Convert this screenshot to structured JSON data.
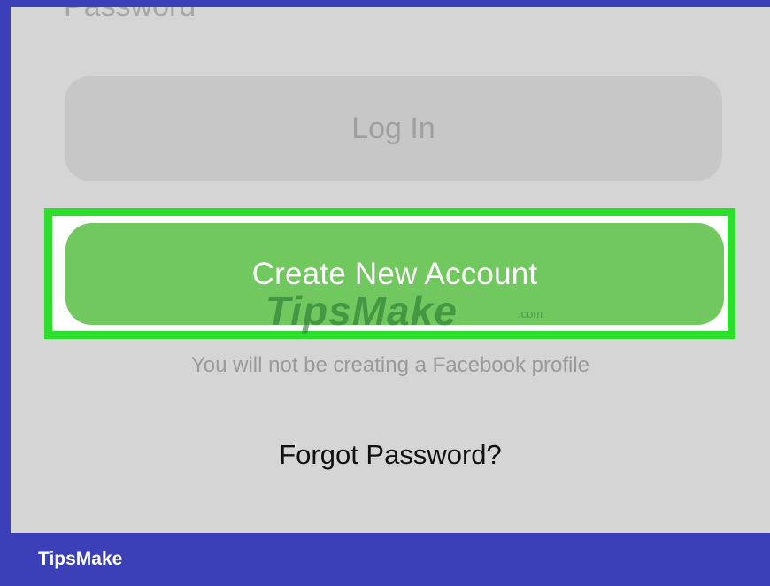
{
  "app": {
    "watermark_brand": "TipsMake",
    "watermark_suffix": ".com",
    "brand_label": "TipsMake"
  },
  "form": {
    "password_label": "Password",
    "login_button": "Log In",
    "create_account_button": "Create New Account",
    "info_text": "You will not be creating a Facebook profile",
    "forgot_password": "Forgot Password?"
  },
  "colors": {
    "frame": "#3b3fb8",
    "screen": "#d5d5d5",
    "login_button": "#c7c7c7",
    "create_button": "#71c85f",
    "highlight": "#2dde2d"
  }
}
